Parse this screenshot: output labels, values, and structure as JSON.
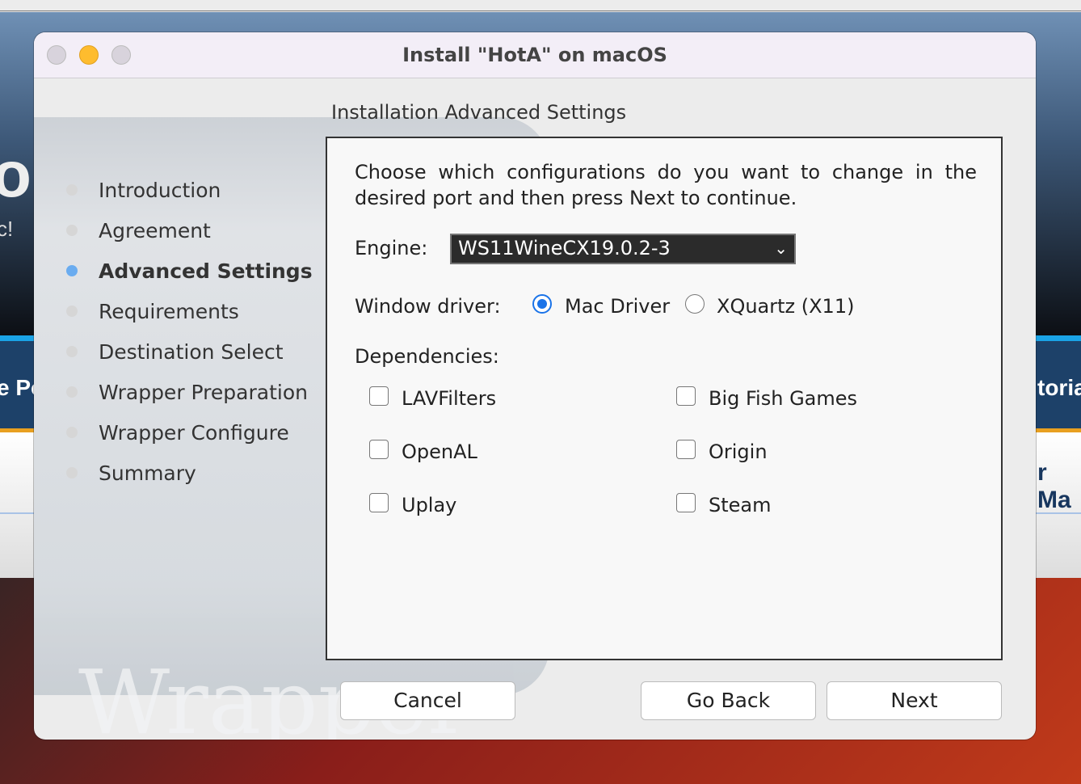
{
  "background": {
    "left_text_1": "or",
    "left_text_2": "c!",
    "left_text_3": "e Po",
    "right_text_1": "toria",
    "right_text_2": "r Ma"
  },
  "window": {
    "title": "Install \"HotA\" on macOS",
    "section_title": "Installation Advanced Settings",
    "art_text": "Wrapper"
  },
  "steps": [
    {
      "label": "Introduction"
    },
    {
      "label": "Agreement"
    },
    {
      "label": "Advanced Settings",
      "active": true
    },
    {
      "label": "Requirements"
    },
    {
      "label": "Destination Select"
    },
    {
      "label": "Wrapper Preparation"
    },
    {
      "label": "Wrapper Configure"
    },
    {
      "label": "Summary"
    }
  ],
  "content": {
    "description": "Choose which configurations do you want to change in the desired port and then press Next to continue.",
    "engine_label": "Engine:",
    "engine_value": "WS11WineCX19.0.2-3",
    "driver_label": "Window driver:",
    "driver_options": [
      {
        "label": "Mac Driver",
        "selected": true
      },
      {
        "label": "XQuartz (X11)",
        "selected": false
      }
    ],
    "deps_label": "Dependencies:",
    "deps": [
      {
        "label": "LAVFilters",
        "checked": false
      },
      {
        "label": "Big Fish Games",
        "checked": false
      },
      {
        "label": "OpenAL",
        "checked": false
      },
      {
        "label": "Origin",
        "checked": false
      },
      {
        "label": "Uplay",
        "checked": false
      },
      {
        "label": "Steam",
        "checked": false
      }
    ]
  },
  "buttons": {
    "cancel": "Cancel",
    "back": "Go Back",
    "next": "Next"
  },
  "colors": {
    "accent": "#1a73e8",
    "active_step": "#6aacf0",
    "minimize": "#febc2e"
  }
}
